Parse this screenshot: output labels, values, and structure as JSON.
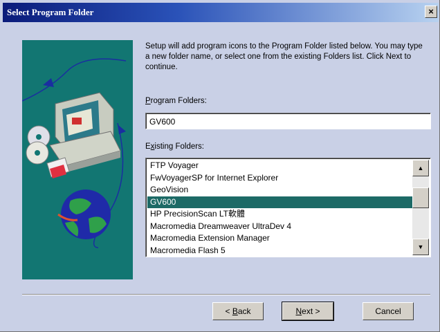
{
  "window": {
    "title": "Select Program Folder",
    "close_glyph": "×"
  },
  "description": "Setup will add program icons to the Program Folder listed below. You may type a new folder name, or select one from the existing Folders list. Click Next to continue.",
  "program_folders": {
    "label_accel": "P",
    "label_rest": "rogram Folders:",
    "value": "GV600"
  },
  "existing_folders": {
    "label_pre": "E",
    "label_accel": "x",
    "label_rest": "isting Folders:",
    "items": [
      "FTP Voyager",
      "FwVoyagerSP for Internet Explorer",
      "GeoVision",
      "GV600",
      "HP PrecisionScan LT軟體",
      "Macromedia Dreamweaver UltraDev 4",
      "Macromedia Extension Manager",
      "Macromedia Flash 5"
    ],
    "selected": "GV600"
  },
  "scrollbar": {
    "up_glyph": "▲",
    "down_glyph": "▼"
  },
  "buttons": {
    "back_pre": "< ",
    "back_accel": "B",
    "back_rest": "ack",
    "next_accel": "N",
    "next_rest": "ext >",
    "cancel": "Cancel"
  },
  "colors": {
    "art_background": "#127672",
    "selection": "#1c6a66",
    "dialog_background": "#c9d0e6"
  }
}
